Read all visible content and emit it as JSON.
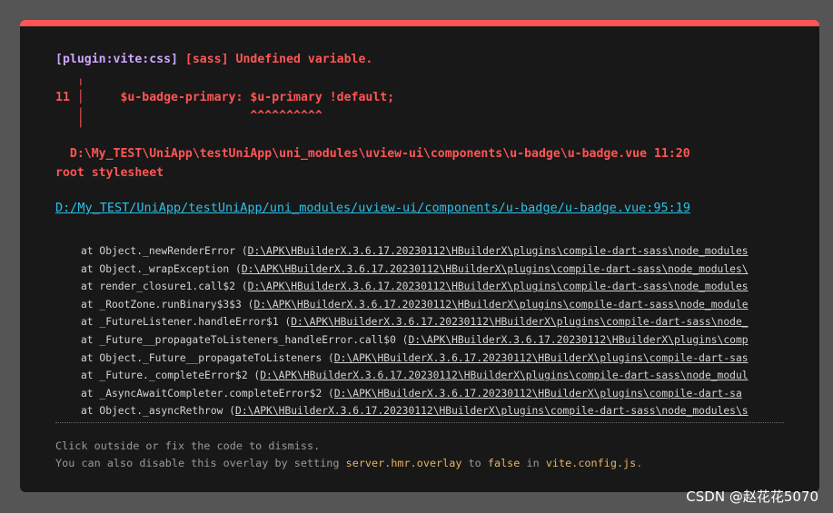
{
  "error": {
    "plugin_tag": "[plugin:vite:css]",
    "message": " [sass] Undefined variable.",
    "frame_line_1": "   ╷",
    "frame_line_2_num": "11",
    "frame_line_2_code": " │     $u-badge-primary: $u-primary !default;",
    "frame_line_3": "   │                       ^^^^^^^^^^",
    "frame_line_4": "   ╵",
    "location": "  D:\\My_TEST\\UniApp\\testUniApp\\uni_modules\\uview-ui\\components\\u-badge\\u-badge.vue 11:20",
    "root": "root stylesheet",
    "file_prefix": "D:",
    "file_link": "/My_TEST/UniApp/testUniApp/uni_modules/uview-ui/components/u-badge/u-badge.vue:95:19"
  },
  "stack": [
    {
      "prefix": "at Object._newRenderError (",
      "path": "D:\\APK\\HBuilderX.3.6.17.20230112\\HBuilderX\\plugins\\compile-dart-sass\\node_modules"
    },
    {
      "prefix": "at Object._wrapException (",
      "path": "D:\\APK\\HBuilderX.3.6.17.20230112\\HBuilderX\\plugins\\compile-dart-sass\\node_modules\\"
    },
    {
      "prefix": "at render_closure1.call$2 (",
      "path": "D:\\APK\\HBuilderX.3.6.17.20230112\\HBuilderX\\plugins\\compile-dart-sass\\node_modules"
    },
    {
      "prefix": "at _RootZone.runBinary$3$3 (",
      "path": "D:\\APK\\HBuilderX.3.6.17.20230112\\HBuilderX\\plugins\\compile-dart-sass\\node_module"
    },
    {
      "prefix": "at _FutureListener.handleError$1 (",
      "path": "D:\\APK\\HBuilderX.3.6.17.20230112\\HBuilderX\\plugins\\compile-dart-sass\\node_"
    },
    {
      "prefix": "at _Future__propagateToListeners_handleError.call$0 (",
      "path": "D:\\APK\\HBuilderX.3.6.17.20230112\\HBuilderX\\plugins\\comp"
    },
    {
      "prefix": "at Object._Future__propagateToListeners (",
      "path": "D:\\APK\\HBuilderX.3.6.17.20230112\\HBuilderX\\plugins\\compile-dart-sas"
    },
    {
      "prefix": "at _Future._completeError$2 (",
      "path": "D:\\APK\\HBuilderX.3.6.17.20230112\\HBuilderX\\plugins\\compile-dart-sass\\node_modul"
    },
    {
      "prefix": "at _AsyncAwaitCompleter.completeError$2 (",
      "path": "D:\\APK\\HBuilderX.3.6.17.20230112\\HBuilderX\\plugins\\compile-dart-sa"
    },
    {
      "prefix": "at Object._asyncRethrow (",
      "path": "D:\\APK\\HBuilderX.3.6.17.20230112\\HBuilderX\\plugins\\compile-dart-sass\\node_modules\\s"
    }
  ],
  "tips": {
    "line1": "Click outside or fix the code to dismiss.",
    "line2_a": "You can also disable this overlay by setting ",
    "line2_code1": "server.hmr.overlay",
    "line2_b": " to ",
    "line2_code2": "false",
    "line2_c": " in ",
    "line2_code3": "vite.config.js",
    "line2_d": "."
  },
  "watermark": "CSDN @赵花花5070",
  "colors": {
    "accent_border": "#ff5555",
    "plugin": "#cfa5ff",
    "error_text": "#ff5555",
    "link": "#2dc1e8",
    "code_highlight": "#e5b55e"
  }
}
